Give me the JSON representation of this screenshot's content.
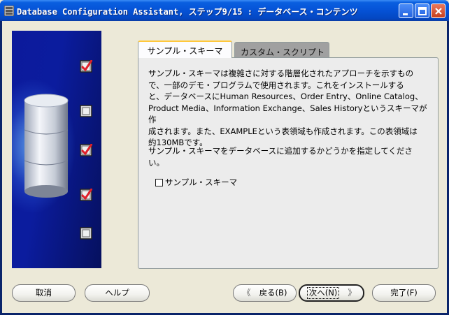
{
  "window": {
    "title": "Database Configuration Assistant, ステップ9/15 : データベース・コンテンツ"
  },
  "sidebar": {
    "steps": [
      {
        "state": "checked"
      },
      {
        "state": "unchecked"
      },
      {
        "state": "checked"
      },
      {
        "state": "checked"
      },
      {
        "state": "unchecked"
      }
    ]
  },
  "tabs": [
    {
      "label": "サンプル・スキーマ",
      "active": true
    },
    {
      "label": "カスタム・スクリプト",
      "active": false
    }
  ],
  "panel": {
    "description_lines": [
      "サンプル・スキーマは複雑さに対する階層化されたアプローチを示すもの",
      "で、一部のデモ・プログラムで使用されます。これをインストールする",
      "と、データベースにHuman Resources、Order Entry、Online Catalog、",
      "Product Media、Information Exchange、Sales Historyというスキーマが作",
      "成されます。また、EXAMPLEという表領域も作成されます。この表領域は",
      "約130MBです。"
    ],
    "prompt_lines": [
      "サンプル・スキーマをデータベースに追加するかどうかを指定してくださ",
      "い。"
    ],
    "checkbox": {
      "label": "サンプル・スキーマ",
      "checked": false
    }
  },
  "buttons": {
    "cancel": "取消",
    "help": "ヘルプ",
    "back_arrow": "《",
    "back": "戻る(B)",
    "next": "次へ(N)",
    "next_arrow": "》",
    "finish": "完了(F)"
  },
  "colors": {
    "titlebar": "#0552d6",
    "sidebar": "#0b1c9e",
    "checkmark": "#e0202a",
    "tab_accent": "#ffc83c"
  }
}
